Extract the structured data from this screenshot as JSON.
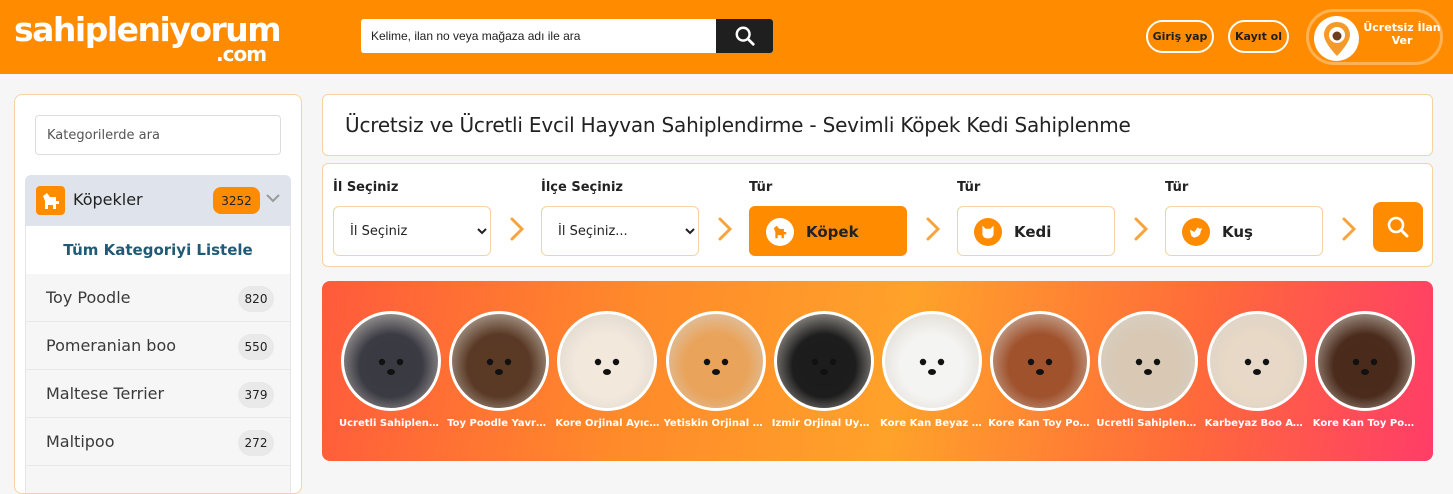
{
  "header": {
    "logo_main": "sahipleniyorum",
    "logo_sub": ".com",
    "search_placeholder": "Kelime, ilan no veya mağaza adı ile ara",
    "login_label": "Giriş yap",
    "register_label": "Kayıt ol",
    "post_ad_label": "Ücretsiz İlan Ver",
    "brand_color": "#ff8c00"
  },
  "sidebar": {
    "search_placeholder": "Kategorilerde ara",
    "category": {
      "title": "Köpekler",
      "count": "3252",
      "icon": "dog-icon"
    },
    "list_all_label": "Tüm Kategoriyi Listele",
    "items": [
      {
        "label": "Toy Poodle",
        "count": "820"
      },
      {
        "label": "Pomeranian boo",
        "count": "550"
      },
      {
        "label": "Maltese Terrier",
        "count": "379"
      },
      {
        "label": "Maltipoo",
        "count": "272"
      }
    ]
  },
  "main": {
    "title": "Ücretsiz ve Ücretli Evcil Hayvan Sahiplendirme - Sevimli Köpek Kedi Sahiplenme"
  },
  "filter": {
    "province_label": "İl Seçiniz",
    "province_value": "İl Seçiniz",
    "district_label": "İlçe Seçiniz",
    "district_value": "İl Seçiniz...",
    "types": [
      {
        "label": "Tür",
        "name": "Köpek",
        "active": true,
        "icon": "dog-icon"
      },
      {
        "label": "Tür",
        "name": "Kedi",
        "active": false,
        "icon": "cat-icon"
      },
      {
        "label": "Tür",
        "name": "Kuş",
        "active": false,
        "icon": "bird-icon"
      }
    ]
  },
  "stories": [
    {
      "label": "Ucretli Sahiplenme",
      "tone": "#3b3b44"
    },
    {
      "label": "Toy Poodle Yavruları",
      "tone": "#5a3a26"
    },
    {
      "label": "Kore Orjinal Ayıcık",
      "tone": "#f2e8dc"
    },
    {
      "label": "Yetiskin Orjinal Boo",
      "tone": "#e9a35a"
    },
    {
      "label": "İzmir Orjinal Uyumlu",
      "tone": "#1d1d1d"
    },
    {
      "label": "Kore Kan Beyaz Poodle",
      "tone": "#f4f4f2"
    },
    {
      "label": "Kore Kan Toy Poodle",
      "tone": "#a0522d"
    },
    {
      "label": "Ucretli Sahiplenme",
      "tone": "#d8c8b4"
    },
    {
      "label": "Karbeyaz Boo Ayıcık",
      "tone": "#e8d8c6"
    },
    {
      "label": "Kore Kan Toy Poodle",
      "tone": "#4a2b1c"
    }
  ]
}
